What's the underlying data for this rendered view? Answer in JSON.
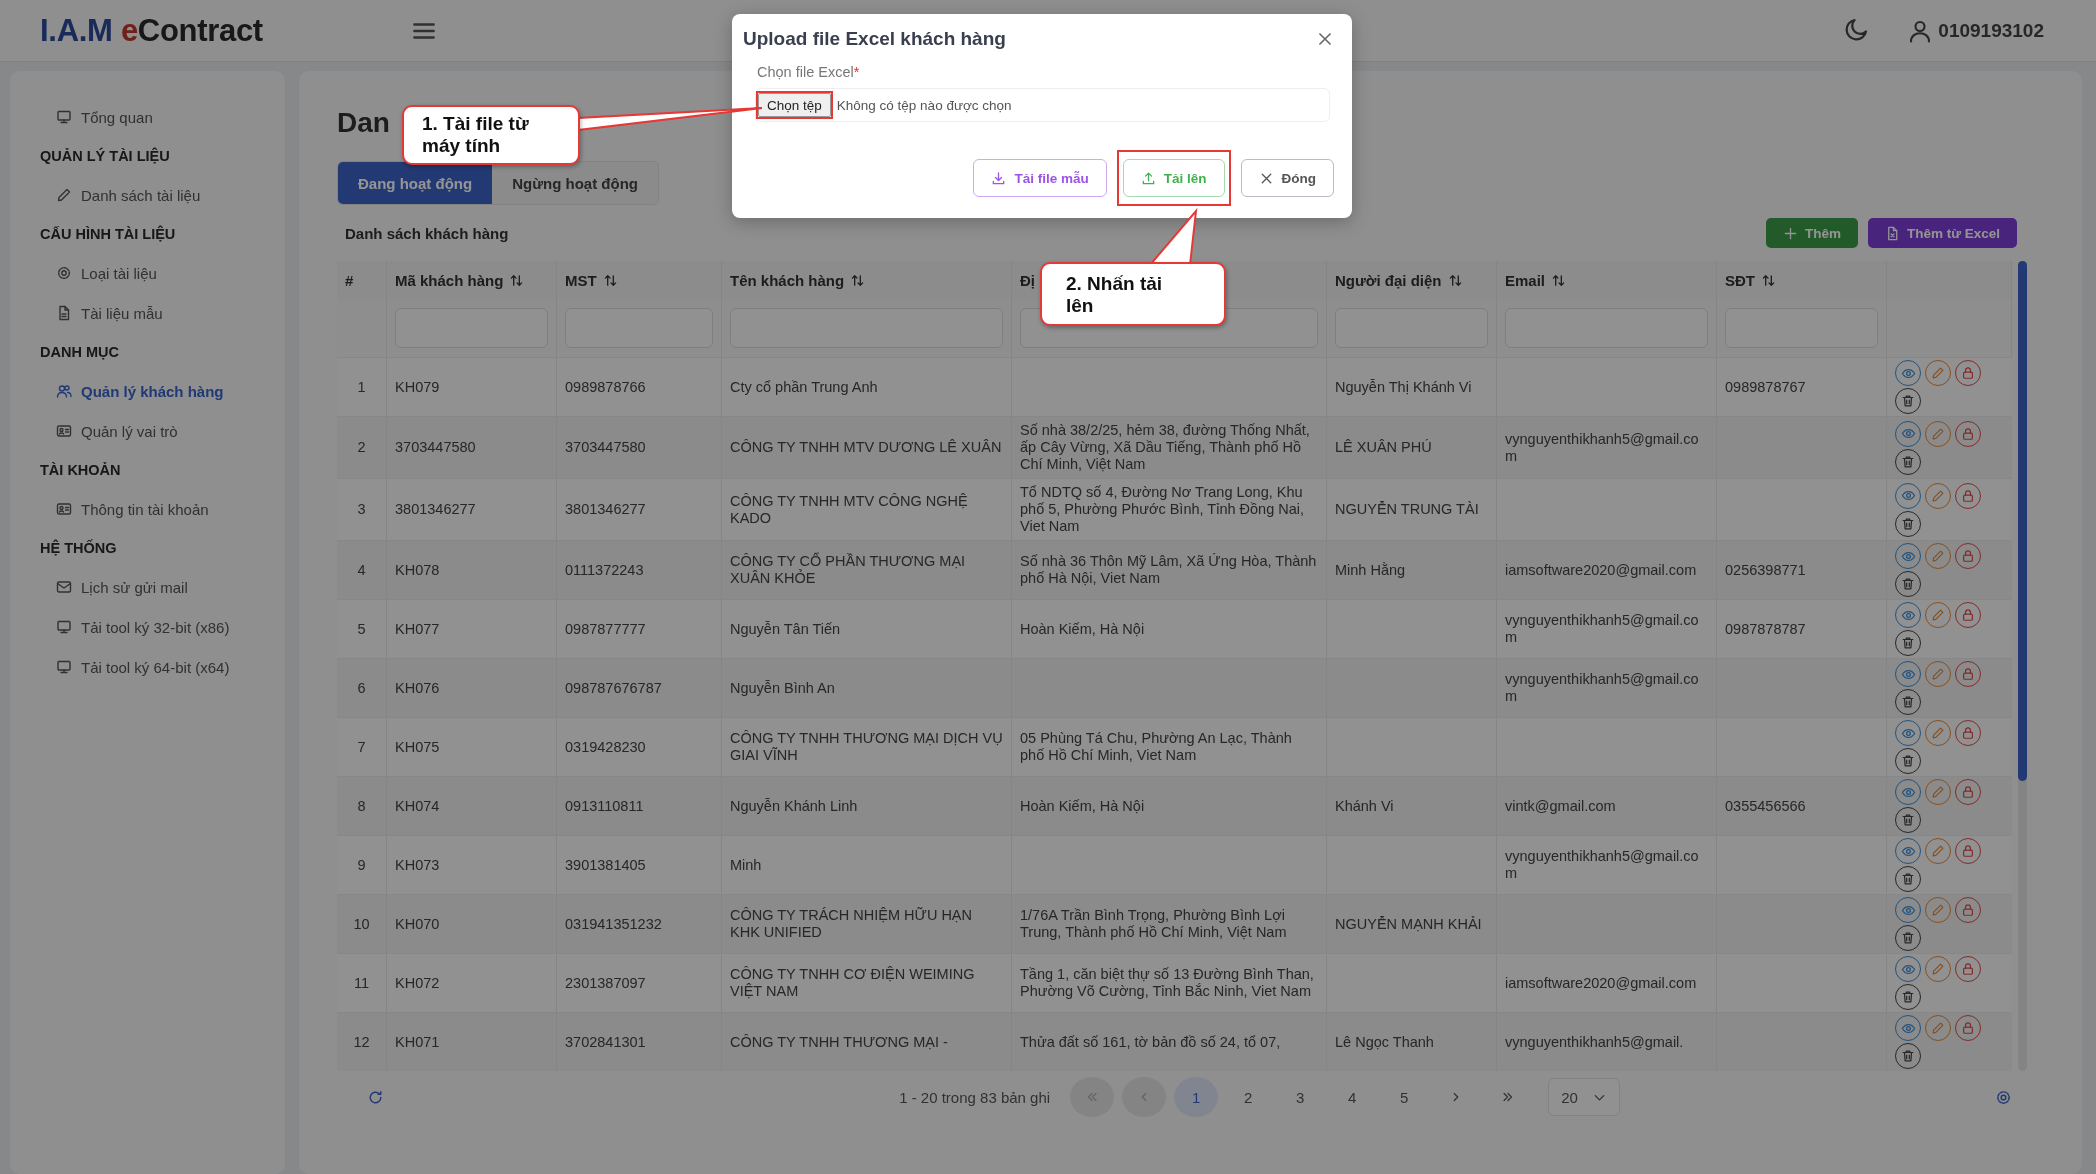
{
  "header": {
    "logo": {
      "brand": "I.A.M",
      "accent": "e",
      "rest": "Contract"
    },
    "user": "0109193102"
  },
  "sidebar": {
    "items": [
      {
        "kind": "item",
        "label": "Tổng quan",
        "selected": false
      },
      {
        "kind": "section",
        "label": "QUẢN LÝ TÀI LIỆU"
      },
      {
        "kind": "item",
        "label": "Danh sách tài liệu",
        "selected": false
      },
      {
        "kind": "section",
        "label": "CẤU HÌNH TÀI LIỆU"
      },
      {
        "kind": "item",
        "label": "Loại tài liệu",
        "selected": false
      },
      {
        "kind": "item",
        "label": "Tài liệu mẫu",
        "selected": false
      },
      {
        "kind": "section",
        "label": "DANH MỤC"
      },
      {
        "kind": "item",
        "label": "Quản lý khách hàng",
        "selected": true
      },
      {
        "kind": "item",
        "label": "Quản lý vai trò",
        "selected": false
      },
      {
        "kind": "section",
        "label": "TÀI KHOẢN"
      },
      {
        "kind": "item",
        "label": "Thông tin tài khoản",
        "selected": false
      },
      {
        "kind": "section",
        "label": "HỆ THỐNG"
      },
      {
        "kind": "item",
        "label": "Lịch sử gửi mail",
        "selected": false
      },
      {
        "kind": "item",
        "label": "Tải tool ký 32-bit (x86)",
        "selected": false
      },
      {
        "kind": "item",
        "label": "Tải tool ký 64-bit (x64)",
        "selected": false
      }
    ]
  },
  "page_title": "Dan",
  "tabs": [
    {
      "label": "Đang hoạt động",
      "selected": true
    },
    {
      "label": "Ngừng hoạt động",
      "selected": false
    }
  ],
  "list_title": "Danh sách khách hàng",
  "actions": [
    {
      "kind": "add",
      "label": "Thêm"
    },
    {
      "kind": "excel",
      "label": "Thêm từ Excel"
    }
  ],
  "table": {
    "columns": [
      {
        "label": "#",
        "sortable": false,
        "filterable": false
      },
      {
        "label": "Mã khách hàng",
        "sortable": true,
        "filterable": true
      },
      {
        "label": "MST",
        "sortable": true,
        "filterable": true
      },
      {
        "label": "Tên khách hàng",
        "sortable": true,
        "filterable": true
      },
      {
        "label": "Đị",
        "sortable": false,
        "filterable": true
      },
      {
        "label": "Người đại diện",
        "sortable": true,
        "filterable": true
      },
      {
        "label": "Email",
        "sortable": true,
        "filterable": true
      },
      {
        "label": "SĐT",
        "sortable": true,
        "filterable": true
      }
    ],
    "rows": [
      {
        "no": "1",
        "code": "KH079",
        "tax_id": "0989878766",
        "name": "Cty cổ phần Trung Anh",
        "representative": "Nguyễn Thị Khánh Vi",
        "phone": "0989878767"
      },
      {
        "no": "2",
        "code": "3703447580",
        "tax_id": "3703447580",
        "name": "CÔNG TY TNHH MTV DƯƠNG LÊ XUÂN",
        "address": "Số nhà 38/2/25, hẻm 38, đường Thống Nhất, ấp Cây Vừng, Xã Dầu Tiếng, Thành phố Hồ Chí Minh, Việt Nam",
        "representative": "LÊ XUÂN PHÚ",
        "email": "vynguyenthikhanh5@gmail.com"
      },
      {
        "no": "3",
        "code": "3801346277",
        "tax_id": "3801346277",
        "name": "CÔNG TY TNHH MTV CÔNG NGHỆ KADO",
        "address": "Tổ NDTQ số 4, Đường Nơ Trang Long, Khu phố 5, Phường Phước Bình, Tỉnh Đồng Nai, Viet Nam",
        "representative": "NGUYỄN TRUNG TÀI"
      },
      {
        "no": "4",
        "code": "KH078",
        "tax_id": "0111372243",
        "name": "CÔNG TY CỔ PHẦN THƯƠNG MẠI XUÂN KHỎE",
        "address": "Số nhà 36 Thôn Mỹ Lâm, Xã Ứng Hòa, Thành phố Hà Nội, Viet Nam",
        "representative": "Minh Hằng",
        "email": "iamsoftware2020@gmail.com",
        "phone": "0256398771"
      },
      {
        "no": "5",
        "code": "KH077",
        "tax_id": "0987877777",
        "name": "Nguyễn Tân Tiến",
        "address": "Hoàn Kiếm, Hà Nội",
        "email": "vynguyenthikhanh5@gmail.com",
        "phone": "0987878787"
      },
      {
        "no": "6",
        "code": "KH076",
        "tax_id": "098787676787",
        "name": "Nguyễn Bình An",
        "email": "vynguyenthikhanh5@gmail.com"
      },
      {
        "no": "7",
        "code": "KH075",
        "tax_id": "0319428230",
        "name": "CÔNG TY TNHH THƯƠNG MẠI DỊCH VỤ GIAI VĨNH",
        "address": "05 Phùng Tá Chu, Phường An Lạc, Thành phố Hồ Chí Minh, Viet Nam"
      },
      {
        "no": "8",
        "code": "KH074",
        "tax_id": "0913110811",
        "name": "Nguyễn Khánh Linh",
        "address": "Hoàn Kiếm, Hà Nội",
        "representative": "Khánh Vi",
        "email": "vintk@gmail.com",
        "phone": "0355456566"
      },
      {
        "no": "9",
        "code": "KH073",
        "tax_id": "3901381405",
        "name": "Minh",
        "email": "vynguyenthikhanh5@gmail.com"
      },
      {
        "no": "10",
        "code": "KH070",
        "tax_id": "031941351232",
        "name": "CÔNG TY TRÁCH NHIỆM HỮU HẠN KHK UNIFIED",
        "address": "1/76A Trần Bình Trọng, Phường Bình Lợi Trung, Thành phố Hồ Chí Minh, Việt Nam",
        "representative": "NGUYỄN MẠNH KHẢI"
      },
      {
        "no": "11",
        "code": "KH072",
        "tax_id": "2301387097",
        "name": "CÔNG TY TNHH CƠ ĐIỆN WEIMING VIỆT NAM",
        "address": "Tầng 1, căn biệt thự số 13 Đường Bình Than, Phường Võ Cường, Tỉnh Bắc Ninh, Viet Nam",
        "email": "iamsoftware2020@gmail.com"
      },
      {
        "no": "12",
        "code": "KH071",
        "tax_id": "3702841301",
        "name": "CÔNG TY TNHH THƯƠNG MẠI -",
        "address": "Thửa đất số 161, tờ bản đồ số 24, tổ 07,",
        "representative": "Lê Ngọc Thanh",
        "email": "vynguyenthikhanh5@gmail."
      }
    ]
  },
  "pagination": {
    "summary": "1 - 20 trong 83 bản ghi",
    "nav": [
      {
        "kind": "first",
        "disabled": true
      },
      {
        "kind": "prev",
        "disabled": true
      },
      {
        "kind": "next",
        "disabled": false
      },
      {
        "kind": "last",
        "disabled": false
      }
    ],
    "pages": [
      {
        "label": "1",
        "selected": true
      },
      {
        "label": "2",
        "selected": false
      },
      {
        "label": "3",
        "selected": false
      },
      {
        "label": "4",
        "selected": false
      },
      {
        "label": "5",
        "selected": false
      }
    ],
    "page_size": "20"
  },
  "modal": {
    "title": "Upload file Excel khách hàng",
    "field_label": "Chọn file Excel",
    "required_mark": "*",
    "file_button": "Chọn tệp",
    "file_status": "Không có tệp nào được chọn",
    "buttons": [
      {
        "kind": "template",
        "label": "Tải file mẫu",
        "highlighted": false
      },
      {
        "kind": "upload",
        "label": "Tải lên",
        "highlighted": true
      },
      {
        "kind": "close",
        "label": "Đóng",
        "highlighted": false
      }
    ]
  },
  "callouts": [
    {
      "text": "1. Tài file từ máy tính"
    },
    {
      "text": "2. Nhấn tải lên"
    }
  ]
}
